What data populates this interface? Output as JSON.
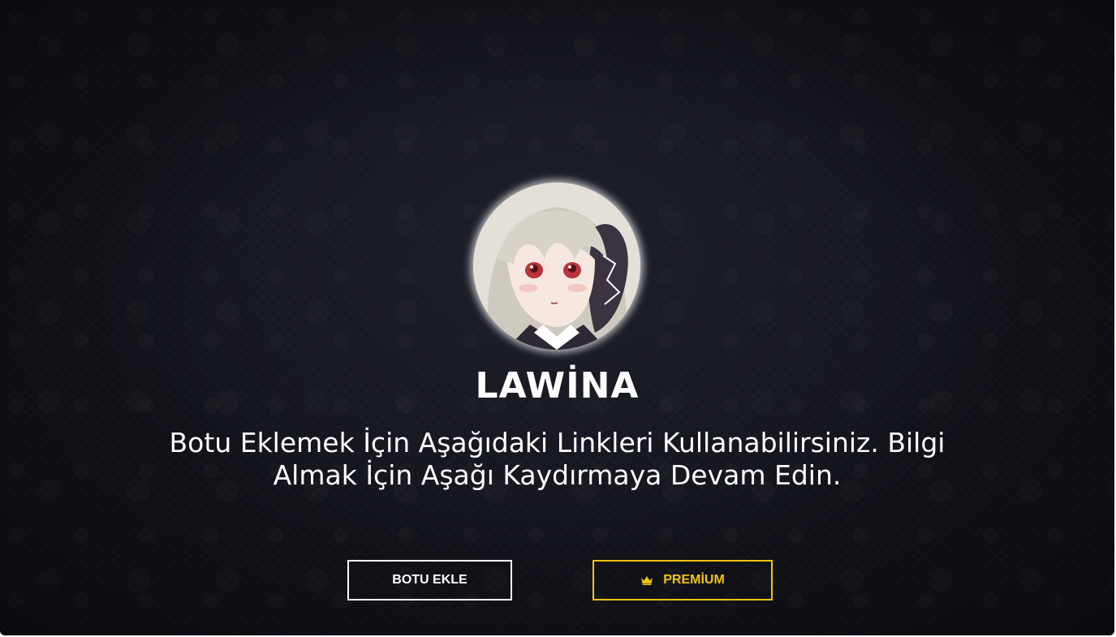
{
  "hero": {
    "title": "LAWİNA",
    "description": "Botu Eklemek İçin Aşağıdaki Linkleri Kullanabilirsiniz. Bilgi Almak İçin Aşağı Kaydırmaya Devam Edin.",
    "avatar_icon": "anime-character-avatar"
  },
  "buttons": {
    "add_bot_label": "BOTU EKLE",
    "premium_label": "PREMİUM",
    "premium_icon": "crown-icon"
  },
  "colors": {
    "background": "#12131a",
    "text": "#ffffff",
    "premium_accent": "#f1c40f"
  }
}
